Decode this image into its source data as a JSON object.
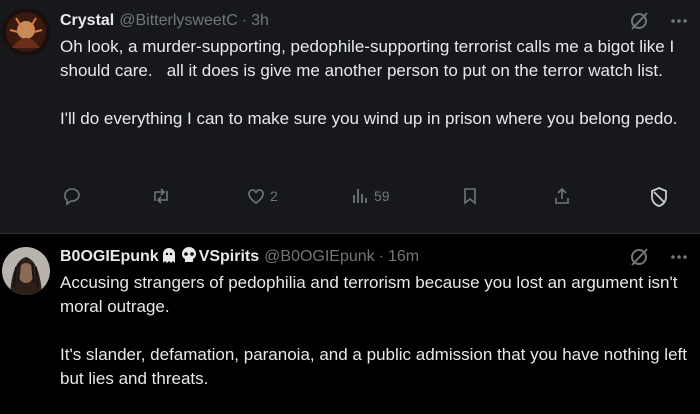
{
  "tweets": [
    {
      "name": "Crystal",
      "handle": "@BitterlysweetC",
      "dot": "·",
      "time": "3h",
      "text": "Oh look, a murder-supporting, pedophile-supporting terrorist calls me a bigot like I should care.   all it does is give me another person to put on the terror watch list.\n\nI'll do everything I can to make sure you wind up in prison where you belong pedo.",
      "likes": "2",
      "views": "59",
      "icons": [
        "grok-icon",
        "more-icon",
        "reply-icon",
        "retweet-icon",
        "like-icon",
        "views-icon",
        "bookmark-icon",
        "share-icon",
        "block-icon"
      ]
    },
    {
      "name_part1": "B0OGIEpunk",
      "name_part2": "VSpirits",
      "handle": "@B0OGIEpunk",
      "dot": "·",
      "time": "16m",
      "text": "Accusing strangers of pedophilia and terrorism because you lost an argument isn't moral outrage.\n\nIt's slander, defamation, paranoia, and a public admission that you have nothing left but lies and threats.",
      "icons": [
        "ghost-emoji-icon",
        "skull-emoji-icon",
        "grok-icon",
        "more-icon"
      ]
    }
  ],
  "colors": {
    "background": "#000000",
    "tweet1_bg": "#16181c",
    "text": "#e7e9ea",
    "muted": "#71767b"
  }
}
